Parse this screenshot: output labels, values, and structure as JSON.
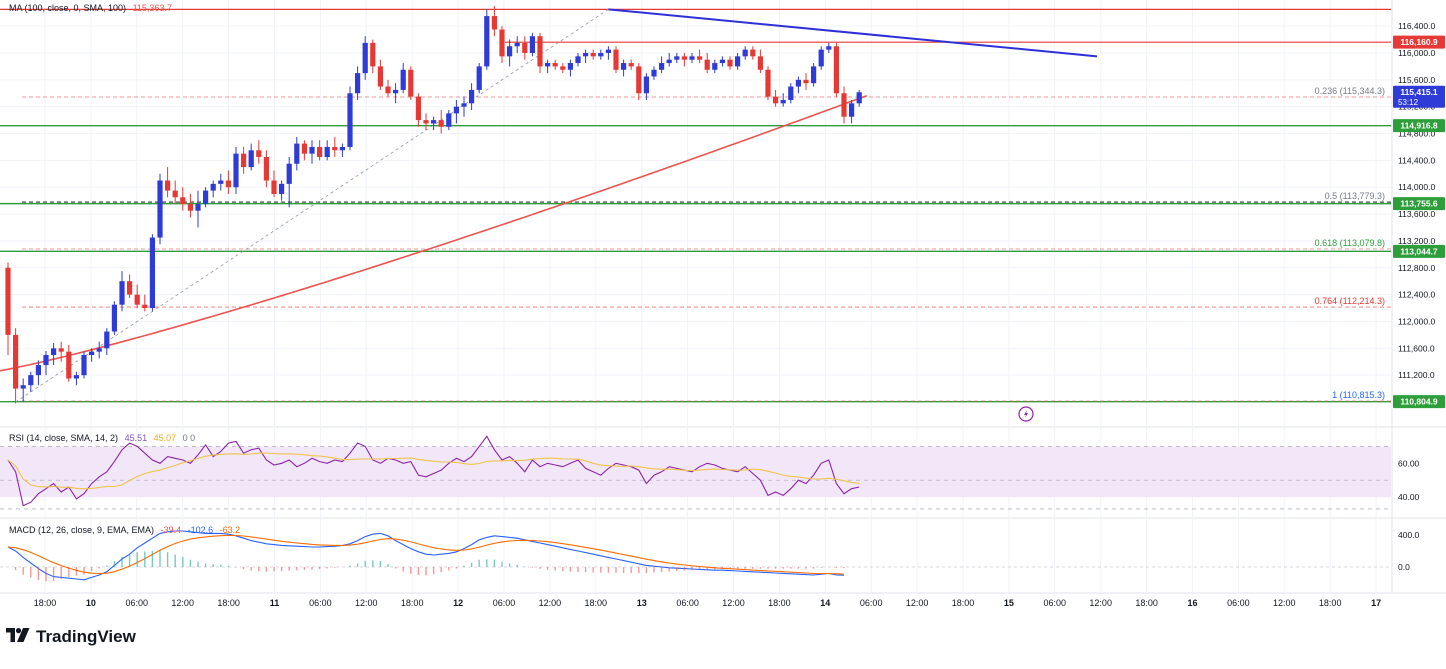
{
  "brand": {
    "name": "TradingView",
    "logo_icon": "tradingview-logo-icon"
  },
  "colors": {
    "up": "#2e3bd6",
    "down": "#e53935",
    "ma": "#ef5350",
    "trendline": "#2f2fd8",
    "support": "#2e9e3a",
    "resistance": "#e53935",
    "fib": "#ef5350",
    "rsi": "#8e24aa",
    "rsi_ma": "#f0c34a",
    "macd": "#2962ff",
    "signal": "#ff6d00"
  },
  "legends": {
    "ma": {
      "label": "MA (100, close, 0, SMA, 100)",
      "value": "115,363.7"
    },
    "rsi": {
      "label": "RSI (14, close, SMA, 14, 2)",
      "rsi": "45.51",
      "ma": "45.07",
      "extra": "0  0"
    },
    "macd": {
      "label": "MACD (12, 26, close, 9, EMA, EMA)",
      "hist": "-39.4",
      "macd": "-102.6",
      "signal": "-63.2"
    }
  },
  "price_axis": {
    "ticks": [
      "116,400.0",
      "116,000.0",
      "115,600.0",
      "115,200.0",
      "114,800.0",
      "114,400.0",
      "114,000.0",
      "113,600.0",
      "113,200.0",
      "112,800.0",
      "112,400.0",
      "112,000.0",
      "111,600.0",
      "111,200.0"
    ],
    "tags": [
      {
        "text": "116,160.9",
        "color": "#e53935"
      },
      {
        "text": "115,415.1",
        "sub": "53:12",
        "color": "#2e3bd6"
      },
      {
        "text": "114,916.8",
        "color": "#2e9e3a"
      },
      {
        "text": "113,755.6",
        "color": "#2e9e3a"
      },
      {
        "text": "113,044.7",
        "color": "#2e9e3a"
      },
      {
        "text": "110,804.9",
        "color": "#2e9e3a"
      }
    ]
  },
  "fib_labels": [
    {
      "level": "0.236",
      "value": "(115,344.3)"
    },
    {
      "level": "0.5",
      "value": "(113,779.3)"
    },
    {
      "level": "0.618",
      "value": "(113,079.8)"
    },
    {
      "level": "0.764",
      "value": "(112,214.3)"
    },
    {
      "level": "1",
      "value": "(110,815.3)"
    }
  ],
  "rsi_axis": [
    "60.00",
    "40.00"
  ],
  "macd_axis": [
    "400.0",
    "0.0"
  ],
  "time_axis": [
    "18:00",
    "10",
    "06:00",
    "12:00",
    "18:00",
    "11",
    "06:00",
    "12:00",
    "18:00",
    "12",
    "06:00",
    "12:00",
    "18:00",
    "13",
    "06:00",
    "12:00",
    "18:00",
    "14",
    "06:00",
    "12:00",
    "18:00",
    "15",
    "06:00",
    "12:00",
    "18:00",
    "16",
    "06:00",
    "12:00",
    "18:00",
    "17"
  ],
  "chart_data": {
    "type": "candlestick",
    "interval_hours": 2,
    "first_candle_time": "9th 12:00",
    "candles": [
      [
        112800,
        112880,
        111500,
        111800
      ],
      [
        111800,
        111900,
        110780,
        111000
      ],
      [
        111000,
        111150,
        110800,
        111050
      ],
      [
        111050,
        111250,
        110950,
        111200
      ],
      [
        111200,
        111420,
        111050,
        111350
      ],
      [
        111350,
        111560,
        111200,
        111500
      ],
      [
        111500,
        111680,
        111350,
        111600
      ],
      [
        111600,
        111700,
        111400,
        111550
      ],
      [
        111550,
        111650,
        111100,
        111150
      ],
      [
        111150,
        111250,
        111050,
        111200
      ],
      [
        111200,
        111550,
        111150,
        111500
      ],
      [
        111500,
        111600,
        111400,
        111550
      ],
      [
        111550,
        111700,
        111450,
        111600
      ],
      [
        111600,
        111900,
        111500,
        111850
      ],
      [
        111850,
        112300,
        111800,
        112250
      ],
      [
        112250,
        112750,
        112150,
        112600
      ],
      [
        112600,
        112700,
        112350,
        112400
      ],
      [
        112400,
        112550,
        112200,
        112250
      ],
      [
        112250,
        112400,
        112150,
        112200
      ],
      [
        112200,
        113300,
        112150,
        113250
      ],
      [
        113250,
        114200,
        113150,
        114100
      ],
      [
        114100,
        114300,
        113850,
        113950
      ],
      [
        113950,
        114100,
        113750,
        113850
      ],
      [
        113850,
        114000,
        113650,
        113750
      ],
      [
        113750,
        113900,
        113550,
        113650
      ],
      [
        113650,
        113950,
        113400,
        113750
      ],
      [
        113750,
        114000,
        113700,
        113950
      ],
      [
        113950,
        114100,
        113850,
        114050
      ],
      [
        114050,
        114200,
        113950,
        114100
      ],
      [
        114100,
        114250,
        113900,
        114000
      ],
      [
        114000,
        114600,
        113900,
        114500
      ],
      [
        114500,
        114600,
        114200,
        114300
      ],
      [
        114300,
        114650,
        114250,
        114550
      ],
      [
        114550,
        114700,
        114350,
        114450
      ],
      [
        114450,
        114550,
        114000,
        114100
      ],
      [
        114100,
        114250,
        113850,
        113900
      ],
      [
        113900,
        114100,
        113800,
        114050
      ],
      [
        114050,
        114450,
        113700,
        114350
      ],
      [
        114350,
        114750,
        114250,
        114650
      ],
      [
        114650,
        114700,
        114400,
        114500
      ],
      [
        114500,
        114700,
        114350,
        114600
      ],
      [
        114600,
        114700,
        114400,
        114450
      ],
      [
        114450,
        114700,
        114400,
        114600
      ],
      [
        114600,
        114750,
        114450,
        114550
      ],
      [
        114550,
        114650,
        114450,
        114600
      ],
      [
        114600,
        115500,
        114550,
        115400
      ],
      [
        115400,
        115800,
        115300,
        115700
      ],
      [
        115700,
        116250,
        115600,
        116150
      ],
      [
        116150,
        116200,
        115700,
        115800
      ],
      [
        115800,
        115900,
        115450,
        115500
      ],
      [
        115500,
        115600,
        115350,
        115400
      ],
      [
        115400,
        115550,
        115250,
        115450
      ],
      [
        115450,
        115850,
        115400,
        115750
      ],
      [
        115750,
        115800,
        115300,
        115350
      ],
      [
        115350,
        115400,
        114900,
        115000
      ],
      [
        115000,
        115100,
        114850,
        114950
      ],
      [
        114950,
        115050,
        114850,
        115000
      ],
      [
        115000,
        115150,
        114800,
        114900
      ],
      [
        114900,
        115150,
        114850,
        115100
      ],
      [
        115100,
        115300,
        114950,
        115200
      ],
      [
        115200,
        115350,
        115050,
        115250
      ],
      [
        115250,
        115550,
        115150,
        115450
      ],
      [
        115450,
        115850,
        115400,
        115800
      ],
      [
        115800,
        116650,
        115750,
        116550
      ],
      [
        116550,
        116700,
        116250,
        116350
      ],
      [
        116350,
        116400,
        115850,
        115950
      ],
      [
        115950,
        116200,
        115800,
        116100
      ],
      [
        116100,
        116250,
        116000,
        116150
      ],
      [
        116150,
        116250,
        115900,
        116000
      ],
      [
        116000,
        116300,
        115950,
        116250
      ],
      [
        116250,
        116300,
        115700,
        115800
      ],
      [
        115800,
        115900,
        115700,
        115850
      ],
      [
        115850,
        115900,
        115750,
        115800
      ],
      [
        115800,
        115850,
        115700,
        115750
      ],
      [
        115750,
        115900,
        115650,
        115850
      ],
      [
        115850,
        116000,
        115800,
        115950
      ],
      [
        115950,
        116050,
        115850,
        116000
      ],
      [
        116000,
        116050,
        115900,
        115950
      ],
      [
        115950,
        116050,
        115900,
        116000
      ],
      [
        116000,
        116100,
        115900,
        116050
      ],
      [
        116050,
        116100,
        115700,
        115750
      ],
      [
        115750,
        115900,
        115650,
        115850
      ],
      [
        115850,
        115900,
        115750,
        115800
      ],
      [
        115800,
        115850,
        115300,
        115400
      ],
      [
        115400,
        115700,
        115300,
        115650
      ],
      [
        115650,
        115800,
        115600,
        115750
      ],
      [
        115750,
        115950,
        115700,
        115850
      ],
      [
        115850,
        116000,
        115800,
        115900
      ],
      [
        115900,
        116000,
        115850,
        115950
      ],
      [
        115950,
        116000,
        115800,
        115900
      ],
      [
        115900,
        116000,
        115850,
        115950
      ],
      [
        115950,
        116050,
        115850,
        115900
      ],
      [
        115900,
        116000,
        115700,
        115750
      ],
      [
        115750,
        115900,
        115700,
        115850
      ],
      [
        115850,
        115950,
        115800,
        115900
      ],
      [
        115900,
        115950,
        115750,
        115800
      ],
      [
        115800,
        116000,
        115750,
        115950
      ],
      [
        115950,
        116100,
        115900,
        116050
      ],
      [
        116050,
        116100,
        115900,
        115950
      ],
      [
        115950,
        116050,
        115700,
        115750
      ],
      [
        115750,
        115800,
        115300,
        115350
      ],
      [
        115350,
        115450,
        115200,
        115250
      ],
      [
        115250,
        115400,
        115200,
        115300
      ],
      [
        115300,
        115550,
        115250,
        115500
      ],
      [
        115500,
        115650,
        115400,
        115600
      ],
      [
        115600,
        115700,
        115450,
        115550
      ],
      [
        115550,
        115850,
        115500,
        115800
      ],
      [
        115800,
        116100,
        115750,
        116050
      ],
      [
        116050,
        116150,
        116000,
        116100
      ],
      [
        116100,
        116150,
        115350,
        115400
      ],
      [
        115400,
        115500,
        114950,
        115050
      ],
      [
        115050,
        115300,
        114950,
        115250
      ],
      [
        115250,
        115450,
        115200,
        115415
      ]
    ],
    "moving_average": {
      "name": "MA 100",
      "start_value": 111250,
      "end_value": 115363.7
    },
    "trendline": {
      "start": 116650,
      "end": 115950
    },
    "horizontal_levels": {
      "resistance": [
        116160.9
      ],
      "support": [
        114916.8,
        113755.6,
        113044.7,
        110804.9
      ],
      "top_line": 116650
    },
    "fib_levels": [
      {
        "ratio": 0.236,
        "price": 115344.3
      },
      {
        "ratio": 0.5,
        "price": 113779.3
      },
      {
        "ratio": 0.618,
        "price": 113079.8
      },
      {
        "ratio": 0.764,
        "price": 112214.3
      },
      {
        "ratio": 1,
        "price": 110815.3
      }
    ],
    "price_range": [
      110780,
      116750
    ],
    "rsi": {
      "overbought_band": [
        40,
        70
      ],
      "values_description": "oscillating 33-72, last 45.51"
    },
    "macd": {
      "last_macd": -102.6,
      "last_signal": -63.2,
      "last_hist": -39.4
    }
  }
}
